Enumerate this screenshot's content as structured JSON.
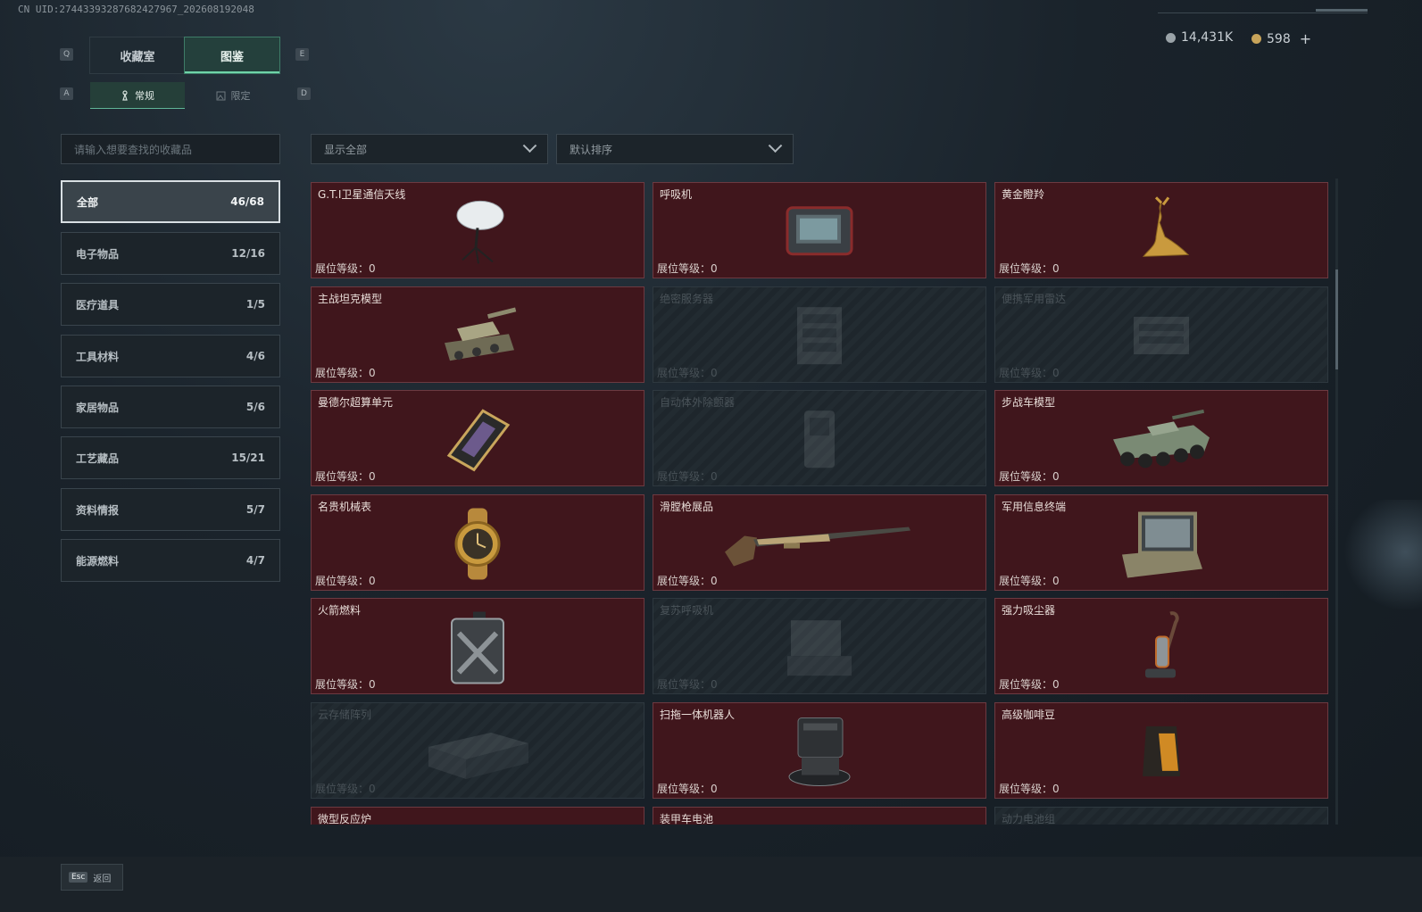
{
  "header": {
    "uid_text": "CN UID:2744339328768242796​7_202608192048",
    "silver_amount": "14,431K",
    "gold_amount": "598",
    "add_label": "+"
  },
  "tabs": {
    "left_key": "Q",
    "right_key": "E",
    "items": [
      {
        "label": "收藏室",
        "active": false
      },
      {
        "label": "图鉴",
        "active": true
      }
    ]
  },
  "subtabs": {
    "left_key": "A",
    "right_key": "D",
    "items": [
      {
        "label": "常规",
        "icon": "pawn-icon",
        "active": true
      },
      {
        "label": "限定",
        "icon": "frame-icon",
        "active": false
      }
    ]
  },
  "search": {
    "placeholder": "请输入想要查找的收藏品"
  },
  "filters": {
    "display": "显示全部",
    "sort": "默认排序"
  },
  "categories": [
    {
      "label": "全部",
      "count": "46/68",
      "active": true
    },
    {
      "label": "电子物品",
      "count": "12/16",
      "active": false
    },
    {
      "label": "医疗道具",
      "count": "1/5",
      "active": false
    },
    {
      "label": "工具材料",
      "count": "4/6",
      "active": false
    },
    {
      "label": "家居物品",
      "count": "5/6",
      "active": false
    },
    {
      "label": "工艺藏品",
      "count": "15/21",
      "active": false
    },
    {
      "label": "资料情报",
      "count": "5/7",
      "active": false
    },
    {
      "label": "能源燃料",
      "count": "4/7",
      "active": false
    }
  ],
  "level_label": "展位等级：",
  "items": [
    {
      "name": "G.T.I卫星通信天线",
      "level": "0",
      "owned": true,
      "icon": "satellite-dish-icon"
    },
    {
      "name": "呼吸机",
      "level": "0",
      "owned": true,
      "icon": "ventilator-icon"
    },
    {
      "name": "黄金瞪羚",
      "level": "0",
      "owned": true,
      "icon": "gold-gazelle-icon"
    },
    {
      "name": "主战坦克模型",
      "level": "0",
      "owned": true,
      "icon": "tank-model-icon"
    },
    {
      "name": "绝密服务器",
      "level": "0",
      "owned": false,
      "icon": "server-icon"
    },
    {
      "name": "便携军用雷达",
      "level": "0",
      "owned": false,
      "icon": "radar-icon"
    },
    {
      "name": "曼德尔超算单元",
      "level": "0",
      "owned": true,
      "icon": "supercomputer-unit-icon"
    },
    {
      "name": "自动体外除颤器",
      "level": "0",
      "owned": false,
      "icon": "defibrillator-icon"
    },
    {
      "name": "步战车模型",
      "level": "0",
      "owned": true,
      "icon": "ifv-model-icon"
    },
    {
      "name": "名贵机械表",
      "level": "0",
      "owned": true,
      "icon": "mechanical-watch-icon"
    },
    {
      "name": "滑膛枪展品",
      "level": "0",
      "owned": true,
      "icon": "musket-icon"
    },
    {
      "name": "军用信息终端",
      "level": "0",
      "owned": true,
      "icon": "military-terminal-icon"
    },
    {
      "name": "火箭燃料",
      "level": "0",
      "owned": true,
      "icon": "fuel-canister-icon"
    },
    {
      "name": "复苏呼吸机",
      "level": "0",
      "owned": false,
      "icon": "resuscitator-icon"
    },
    {
      "name": "强力吸尘器",
      "level": "0",
      "owned": true,
      "icon": "vacuum-cleaner-icon"
    },
    {
      "name": "云存储阵列",
      "level": "0",
      "owned": false,
      "icon": "storage-array-icon"
    },
    {
      "name": "扫拖一体机器人",
      "level": "0",
      "owned": true,
      "icon": "robot-vacuum-icon"
    },
    {
      "name": "高级咖啡豆",
      "level": "0",
      "owned": true,
      "icon": "coffee-bag-icon"
    },
    {
      "name": "微型反应炉",
      "level": "",
      "owned": true,
      "icon": "reactor-icon"
    },
    {
      "name": "装甲车电池",
      "level": "",
      "owned": true,
      "icon": "vehicle-battery-icon"
    },
    {
      "name": "动力电池组",
      "level": "",
      "owned": false,
      "icon": "battery-pack-icon"
    }
  ],
  "footer": {
    "esc_key": "Esc",
    "back_label": "返回"
  },
  "colors": {
    "owned_card": "#40161c",
    "accent": "#6fd3a8",
    "locked_card": "#1e262c"
  }
}
